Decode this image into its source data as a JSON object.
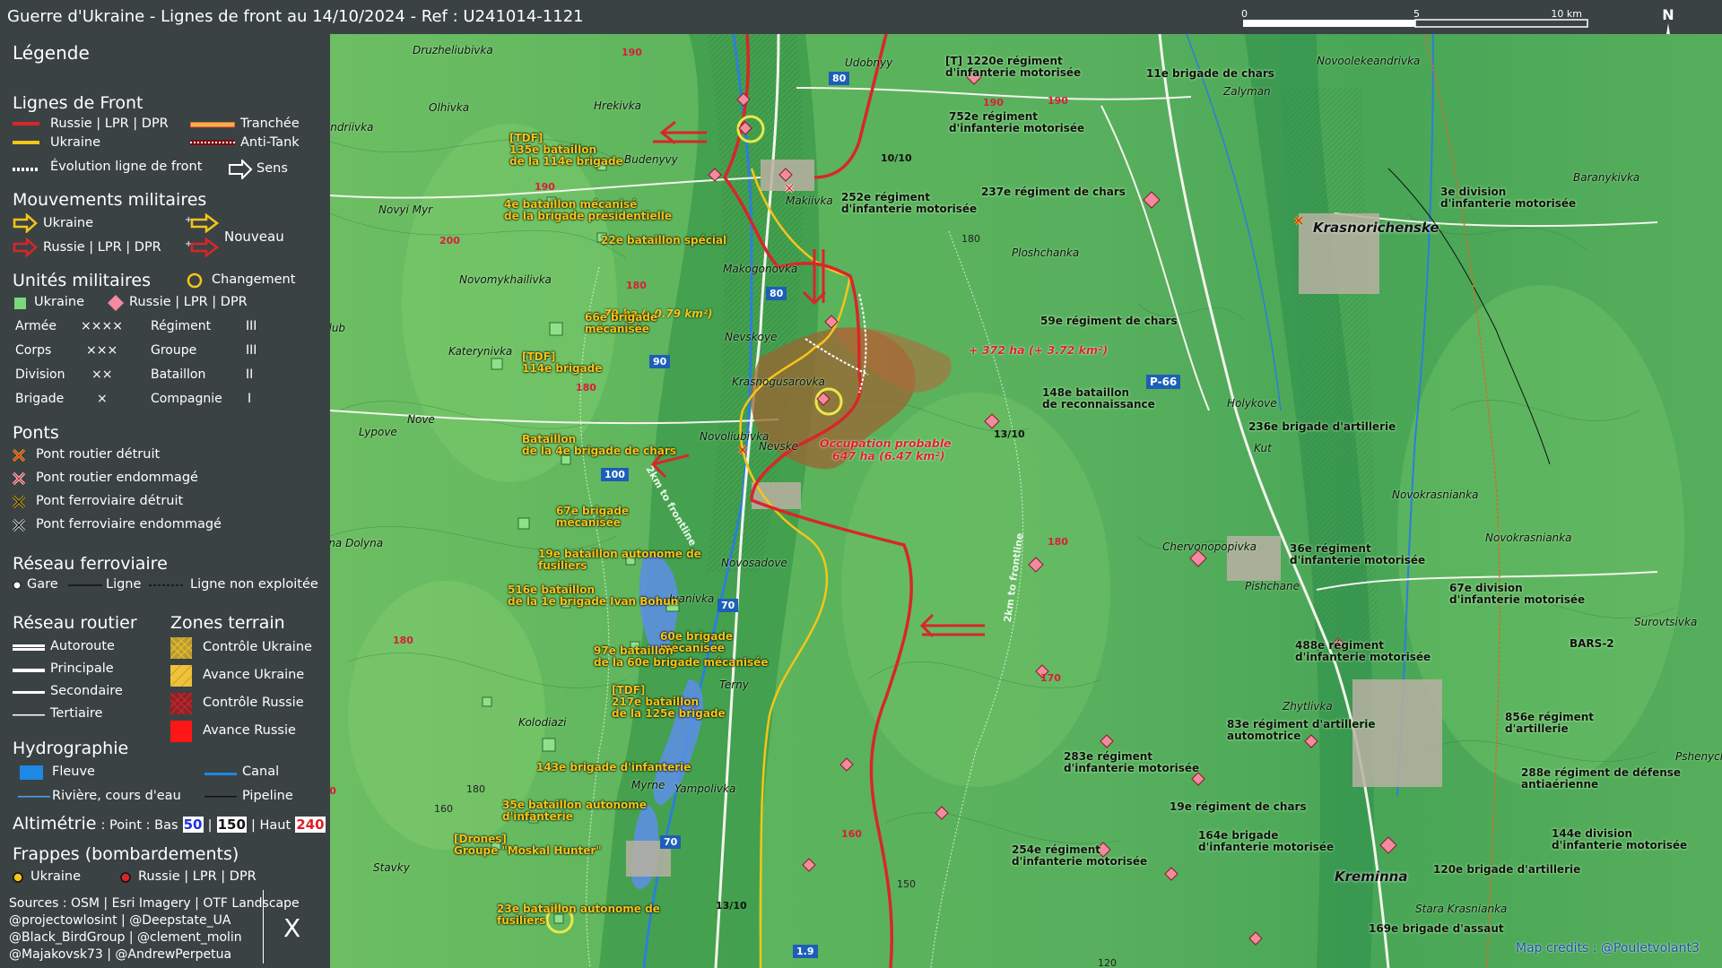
{
  "title": "Guerre d'Ukraine - Lignes de front au 14/10/2024 - Ref : U241014-1121",
  "scale": {
    "ticks": [
      "0",
      "5",
      "10 km"
    ]
  },
  "north_label": "N",
  "legend": {
    "title": "Légende",
    "front": {
      "heading": "Lignes de Front",
      "russia": "Russie | LPR | DPR",
      "ukraine": "Ukraine",
      "evolution": "Évolution ligne de front",
      "trench": "Tranchée",
      "antitank": "Anti-Tank",
      "direction": "Sens"
    },
    "movements": {
      "heading": "Mouvements militaires",
      "ukraine": "Ukraine",
      "russia": "Russie | LPR | DPR",
      "new": "Nouveau"
    },
    "units": {
      "heading": "Unités militaires",
      "change": "Changement",
      "ukraine": "Ukraine",
      "russia": "Russie | LPR | DPR",
      "rows": [
        {
          "a": "Armée",
          "as": "××××",
          "b": "Régiment",
          "bs": "III"
        },
        {
          "a": "Corps",
          "as": "×××",
          "b": "Groupe",
          "bs": "III"
        },
        {
          "a": "Division",
          "as": "××",
          "b": "Bataillon",
          "bs": "II"
        },
        {
          "a": "Brigade",
          "as": "×",
          "b": "Compagnie",
          "bs": "I"
        }
      ]
    },
    "bridges": {
      "heading": "Ponts",
      "items": [
        "Pont routier détruit",
        "Pont routier endommagé",
        "Pont ferroviaire détruit",
        "Pont ferroviaire endommagé"
      ]
    },
    "rail": {
      "heading": "Réseau ferroviaire",
      "station": "Gare",
      "line": "Ligne",
      "unused": "Ligne non exploitée"
    },
    "roads": {
      "heading": "Réseau routier",
      "items": [
        "Autoroute",
        "Principale",
        "Secondaire",
        "Tertiaire"
      ]
    },
    "zones": {
      "heading": "Zones terrain",
      "items": [
        "Contrôle Ukraine",
        "Avance Ukraine",
        "Contrôle Russie",
        "Avance Russie"
      ]
    },
    "hydro": {
      "heading": "Hydrographie",
      "river": "Fleuve",
      "canal": "Canal",
      "stream": "Rivière, cours d'eau",
      "pipeline": "Pipeline"
    },
    "altimetry": {
      "heading": "Altimétrie",
      "text": ": Point : Bas",
      "low": "50",
      "mid": "150",
      "high_label": "| Haut",
      "high": "240"
    },
    "strikes": {
      "heading": "Frappes (bombardements)",
      "ukraine": "Ukraine",
      "russia": "Russie | LPR | DPR"
    },
    "sources": [
      "Sources : OSM | Esri Imagery | OTF Landscape",
      "@projectowlosint | @Deepstate_UA",
      "@Black_BirdGroup | @clement_molin",
      "@Majakovsk73 | @AndrewPerpetua"
    ],
    "x_logo": "X"
  },
  "colors": {
    "russia": "#d8262a",
    "ukraine": "#f5c518",
    "land_light": "#6fc66a",
    "land_dark": "#2f9a4a",
    "water": "#5b8fe0"
  },
  "map": {
    "credits": "Map credits : @Pouletvolant3",
    "front_labels": {
      "ua_change": "- 79 ha (- 0.79 km²)",
      "ru_change": "+ 372 ha (+ 3.72 km²)",
      "occupation_1": "Occupation probable",
      "occupation_2": "647 ha (6.47 km²)",
      "frontline_1": "2km to frontline",
      "frontline_2": "2km to frontline"
    },
    "big_towns": [
      "Krasnorichenske",
      "Kreminna"
    ],
    "towns": [
      "Druzheliubivka",
      "Olhivka",
      "Andriivka",
      "Hrekivka",
      "Novyi Myr",
      "Budenyvy",
      "Makiivka",
      "Novomykhailivka",
      "Makogonovka",
      "Nevskoye",
      "Katerynivka",
      "Krasnogusarovka",
      "Lypove",
      "Nove",
      "Novoliubivka",
      "Nevske",
      "Zelena Dolyna",
      "Novosadove",
      "Ivanivka",
      "Terny",
      "Kolodiazi",
      "Myrne",
      "Yampolivka",
      "Stavky",
      "Udobnyy",
      "Ploshchanka",
      "Holykove",
      "Kut",
      "Chervonopopivka",
      "Pishchane",
      "Zhytlivka",
      "Novoolekeandrivka",
      "Zalyman",
      "Baranykivka",
      "Novokrasnianka",
      "Novokrasnianka",
      "Surovtsivka",
      "Pshenych",
      "Stara Krasnianka",
      "Podkolub"
    ],
    "altitudes": [
      "190",
      "190",
      "190",
      "200",
      "180",
      "180",
      "170",
      "160",
      "180",
      "180",
      "190",
      "170",
      "160",
      "150",
      "120",
      "180",
      "180"
    ],
    "road_shields": [
      "80",
      "80",
      "90",
      "100",
      "70",
      "70",
      "P-66",
      "1.9"
    ],
    "change_dates": [
      "10/10",
      "13/10",
      "13/10"
    ],
    "ukraine_units": [
      "[TDF]\n135e bataillon\nde la 114e brigade",
      "4e bataillon mécanisé\nde la brigade présidentielle",
      "22e bataillon spécial",
      "66e brigade\nmécanisée",
      "[TDF]\n114e brigade",
      "Bataillon\nde la 4e brigade de chars",
      "67e brigade\nmécanisée",
      "19e bataillon autonome de\nfusiliers",
      "516e bataillon\nde la 1e brigade Ivan Bohun",
      "60e brigade\nmécanisée",
      "97e bataillon\nde la 60e brigade mécanisée",
      "[TDF]\n217e bataillon\nde la 125e brigade",
      "143e brigade d'infanterie",
      "35e bataillon autonome\nd'infanterie",
      "[Drones]\nGroupe \"Moskal Hunter\"",
      "23e bataillon autonome de\nfusiliers"
    ],
    "russia_units": [
      "[T] 1220e régiment\nd'infanterie motorisée",
      "752e régiment\nd'infanterie motorisée",
      "252e régiment\nd'infanterie motorisée",
      "237e régiment de chars",
      "11e brigade de chars",
      "3e division\nd'infanterie motorisée",
      "59e régiment de chars",
      "148e bataillon\nde reconnaissance",
      "236e brigade d'artillerie",
      "36e régiment\nd'infanterie motorisée",
      "67e division\nd'infanterie motorisée",
      "488e régiment\nd'infanterie motorisée",
      "BARS-2",
      "83e régiment d'artillerie\nautomotrice",
      "856e régiment\nd'artillerie",
      "283e régiment\nd'infanterie motorisée",
      "288e régiment de défense\nantiaérienne",
      "19e régiment de chars",
      "164e brigade\nd'infanterie motorisée",
      "144e division\nd'infanterie motorisée",
      "254e régiment\nd'infanterie motorisée",
      "120e brigade d'artillerie",
      "169e brigade d'assaut"
    ]
  }
}
